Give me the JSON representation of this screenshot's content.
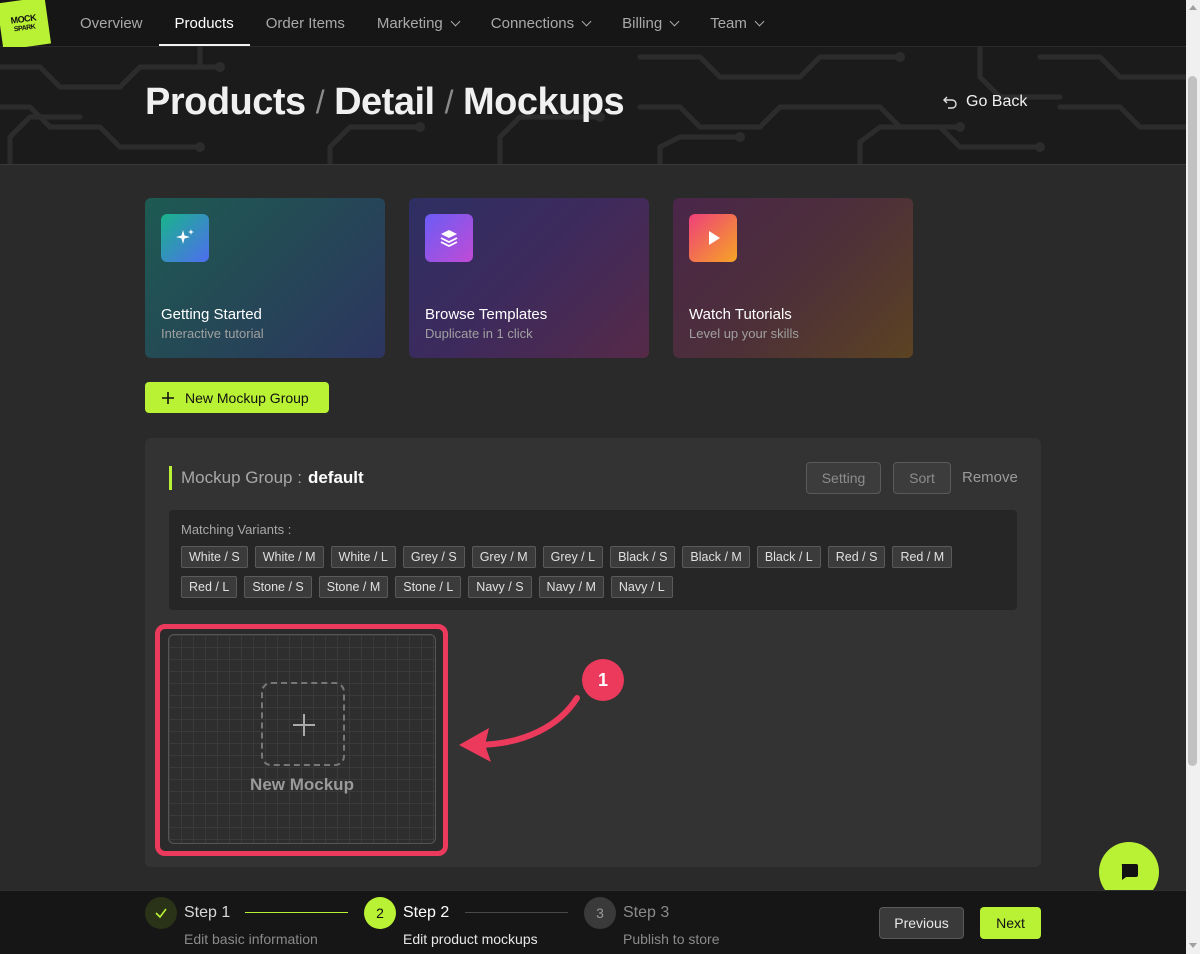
{
  "brand": {
    "logo_line1": "MOCK",
    "logo_line2": "SPARK",
    "accent": "#b9f135",
    "highlight": "#ec3a5d"
  },
  "nav": {
    "items": [
      {
        "label": "Overview",
        "active": false,
        "dropdown": false
      },
      {
        "label": "Products",
        "active": true,
        "dropdown": false
      },
      {
        "label": "Order Items",
        "active": false,
        "dropdown": false
      },
      {
        "label": "Marketing",
        "active": false,
        "dropdown": true
      },
      {
        "label": "Connections",
        "active": false,
        "dropdown": true
      },
      {
        "label": "Billing",
        "active": false,
        "dropdown": true
      },
      {
        "label": "Team",
        "active": false,
        "dropdown": true
      }
    ]
  },
  "header": {
    "breadcrumb": [
      "Products",
      "Detail",
      "Mockups"
    ],
    "separator": "/",
    "go_back": "Go Back"
  },
  "cards": [
    {
      "title": "Getting Started",
      "subtitle": "Interactive tutorial",
      "icon": "sparkles-icon"
    },
    {
      "title": "Browse Templates",
      "subtitle": "Duplicate in 1 click",
      "icon": "layers-icon"
    },
    {
      "title": "Watch Tutorials",
      "subtitle": "Level up your skills",
      "icon": "play-icon"
    }
  ],
  "new_group_button": "New Mockup Group",
  "group": {
    "label": "Mockup Group :",
    "name": "default",
    "setting": "Setting",
    "sort": "Sort",
    "remove": "Remove",
    "variants_label": "Matching Variants :",
    "variants": [
      "White / S",
      "White / M",
      "White / L",
      "Grey / S",
      "Grey / M",
      "Grey / L",
      "Black / S",
      "Black / M",
      "Black / L",
      "Red / S",
      "Red / M",
      "Red / L",
      "Stone / S",
      "Stone / M",
      "Stone / L",
      "Navy / S",
      "Navy / M",
      "Navy / L"
    ],
    "new_mockup": "New Mockup"
  },
  "annotation_badge": "1",
  "stepper": {
    "steps": [
      {
        "title": "Step 1",
        "desc": "Edit basic information",
        "state": "done",
        "number": ""
      },
      {
        "title": "Step 2",
        "desc": "Edit product mockups",
        "state": "current",
        "number": "2"
      },
      {
        "title": "Step 3",
        "desc": "Publish to store",
        "state": "pending",
        "number": "3"
      }
    ],
    "previous": "Previous",
    "next": "Next"
  }
}
